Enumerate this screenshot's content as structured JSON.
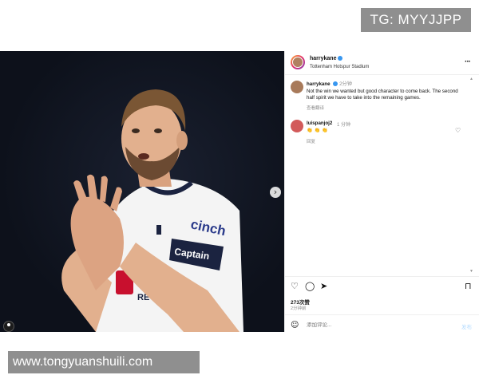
{
  "watermark_top": "TG: MYYJJPP",
  "watermark_bottom": "www.tongyuanshuili.com",
  "photo": {
    "shirt_sponsor": "cinch",
    "armband_text": "Captain",
    "badge_text": "AIA",
    "sleeve_text": "RE DREA"
  },
  "post": {
    "username": "harrykane",
    "location": "Tottenham Hotspur Stadium",
    "caption_username": "harrykane",
    "caption_time": "2分钟",
    "caption_text": "Not the win we wanted but good character to come back. The second half spirit we have to take into the remaining games.",
    "translate_label": "查看翻译",
    "likes": "273次赞",
    "time_ago": "2分钟前"
  },
  "comments": [
    {
      "username": "luispanjoj2",
      "time": "1 分钟",
      "text": "👏👏👏",
      "reply_label": "回复"
    }
  ],
  "comment_box": {
    "placeholder": "添加评论...",
    "post_label": "发布"
  },
  "icons": {
    "more": "more-options-icon",
    "heart": "heart-icon",
    "comment": "comment-icon",
    "share": "share-icon",
    "save": "bookmark-icon",
    "emoji": "emoji-icon",
    "next": "chevron-right-icon",
    "tag": "user-tag-icon"
  },
  "colors": {
    "verified": "#3897f0",
    "post_button": "#b3dbff",
    "muted": "#8e8e8e"
  }
}
